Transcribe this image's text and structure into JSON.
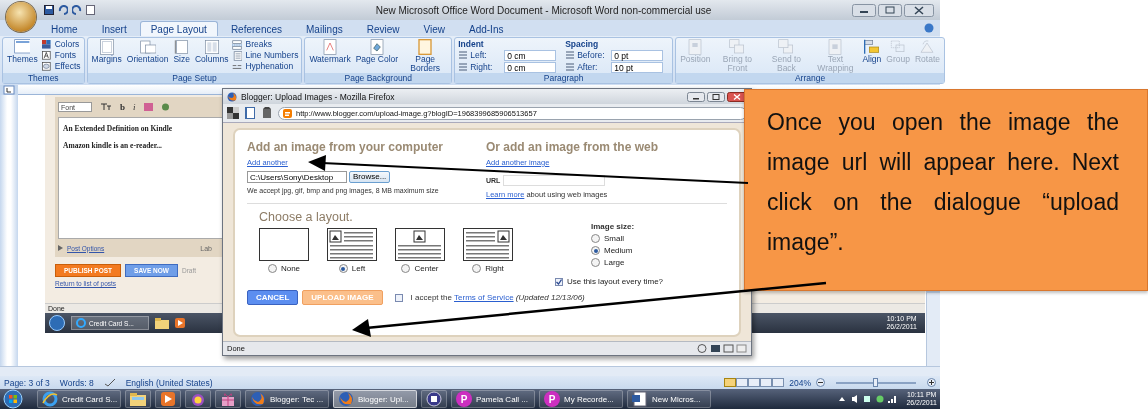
{
  "word_window": {
    "title": "New Microsoft Office Word Document - Microsoft Word non-commercial use",
    "tabs": [
      {
        "label": "Home",
        "selected": false
      },
      {
        "label": "Insert",
        "selected": false
      },
      {
        "label": "Page Layout",
        "selected": true
      },
      {
        "label": "References",
        "selected": false
      },
      {
        "label": "Mailings",
        "selected": false
      },
      {
        "label": "Review",
        "selected": false
      },
      {
        "label": "View",
        "selected": false
      },
      {
        "label": "Add-Ins",
        "selected": false
      }
    ],
    "ribbon_groups": [
      {
        "label": "Themes",
        "items": [
          {
            "kind": "large",
            "label": "Themes",
            "disabled": false
          },
          {
            "kind": "small",
            "label": "Colors",
            "disabled": false
          },
          {
            "kind": "small",
            "label": "Fonts",
            "disabled": false
          },
          {
            "kind": "small",
            "label": "Effects",
            "disabled": false
          }
        ]
      },
      {
        "label": "Page Setup",
        "items": [
          {
            "kind": "large",
            "label": "Margins",
            "disabled": false
          },
          {
            "kind": "large",
            "label": "Orientation",
            "disabled": false
          },
          {
            "kind": "large",
            "label": "Size",
            "disabled": false
          },
          {
            "kind": "large",
            "label": "Columns",
            "disabled": false
          },
          {
            "kind": "small",
            "label": "Breaks",
            "disabled": false
          },
          {
            "kind": "small",
            "label": "Line Numbers",
            "disabled": false
          },
          {
            "kind": "small",
            "label": "Hyphenation",
            "disabled": false
          }
        ]
      },
      {
        "label": "Page Background",
        "items": [
          {
            "kind": "large",
            "label": "Watermark",
            "disabled": false
          },
          {
            "kind": "large",
            "label": "Page Color",
            "disabled": false
          },
          {
            "kind": "large",
            "label": "Page Borders",
            "disabled": false
          }
        ]
      },
      {
        "label": "Paragraph",
        "items": [
          {
            "kind": "fields",
            "heading": "Indent",
            "fields": [
              {
                "label": "Left:",
                "value": "0 cm"
              },
              {
                "label": "Right:",
                "value": "0 cm"
              }
            ]
          },
          {
            "kind": "fields",
            "heading": "Spacing",
            "fields": [
              {
                "label": "Before:",
                "value": "0 pt"
              },
              {
                "label": "After:",
                "value": "10 pt"
              }
            ]
          }
        ]
      },
      {
        "label": "Arrange",
        "items": [
          {
            "kind": "large",
            "label": "Position",
            "disabled": true
          },
          {
            "kind": "large",
            "label": "Bring to Front",
            "disabled": true
          },
          {
            "kind": "large",
            "label": "Send to Back",
            "disabled": true
          },
          {
            "kind": "large",
            "label": "Text Wrapping",
            "disabled": true
          },
          {
            "kind": "large",
            "label": "Align",
            "disabled": false
          },
          {
            "kind": "large",
            "label": "Group",
            "disabled": true
          },
          {
            "kind": "large",
            "label": "Rotate",
            "disabled": true
          }
        ]
      }
    ]
  },
  "document_image": {
    "font_select": "Font",
    "bold": "b",
    "italic": "i",
    "title_line": "An Extended Definition on Kindle",
    "body_line": "Amazon kindle is an e-reader...",
    "post_options": "Post Options",
    "labels_cut": "Lab",
    "publish": "PUBLISH POST",
    "save": "SAVE NOW",
    "draft_cut": "Draft",
    "return_link": "Return to list of posts",
    "status": "Done",
    "taskbar_item": "Credit Card S...",
    "clock_time": "10:10 PM",
    "clock_date": "26/2/2011"
  },
  "upload_dialog": {
    "title": "Blogger: Upload Images - Mozilla Firefox",
    "url": "http://www.blogger.com/upload-image.g?blogID=1968399685906513657",
    "computer_heading": "Add an image from your computer",
    "computer_link": "Add another",
    "file_value": "C:\\Users\\Sony\\Desktop",
    "browse": "Browse...",
    "file_note": "We accept jpg, gif, bmp and png images, 8 MB maximum size",
    "web_heading": "Or add an image from the web",
    "web_link": "Add another image",
    "url_label": "URL",
    "learn_more": "Learn more",
    "learn_more_rest": " about using web images",
    "layout_heading": "Choose a layout.",
    "layouts": [
      {
        "kind": "none",
        "label": "None",
        "selected": false
      },
      {
        "kind": "left",
        "label": "Left",
        "selected": true
      },
      {
        "kind": "center",
        "label": "Center",
        "selected": false
      },
      {
        "kind": "right",
        "label": "Right",
        "selected": false
      }
    ],
    "size_heading": "Image size:",
    "sizes": [
      {
        "label": "Small",
        "selected": false
      },
      {
        "label": "Medium",
        "selected": true
      },
      {
        "label": "Large",
        "selected": false
      }
    ],
    "remember": {
      "label": "Use this layout every time?",
      "checked": true
    },
    "cancel": "CANCEL",
    "upload": "UPLOAD IMAGE",
    "accept": {
      "checked": false,
      "before": "I accept the ",
      "link": "Terms of Service",
      "after": "(Updated 12/13/06)"
    },
    "status": "Done"
  },
  "callout": {
    "text": "Once you open the image the image url will appear here. Next click on the dialogue “upload image”."
  },
  "status_bar": {
    "page": "Page: 3 of 3",
    "words": "Words: 8",
    "language": "English (United States)",
    "zoom": "204%",
    "zoom_slider": {
      "level": 0.5
    }
  },
  "taskbar": {
    "items": [
      {
        "kind": "ie",
        "label": "Credit Card S...",
        "selected": false
      },
      {
        "kind": "folder",
        "selected": false
      },
      {
        "kind": "media",
        "selected": false
      },
      {
        "kind": "messenger",
        "selected": false
      },
      {
        "kind": "gift",
        "selected": false
      },
      {
        "kind": "firefox",
        "label": "Blogger: Tec ...",
        "selected": false
      },
      {
        "kind": "firefox",
        "label": "Blogger: Upl...",
        "selected": true
      },
      {
        "kind": "app",
        "selected": false
      },
      {
        "kind": "letter",
        "letter": "P",
        "label": "Pamela Call ...",
        "selected": false
      },
      {
        "kind": "letter",
        "letter": "P",
        "label": "My Recorde...",
        "selected": false
      },
      {
        "kind": "word",
        "label": "New Micros...",
        "selected": false
      }
    ],
    "time": "10:11 PM",
    "date": "26/2/2011"
  }
}
